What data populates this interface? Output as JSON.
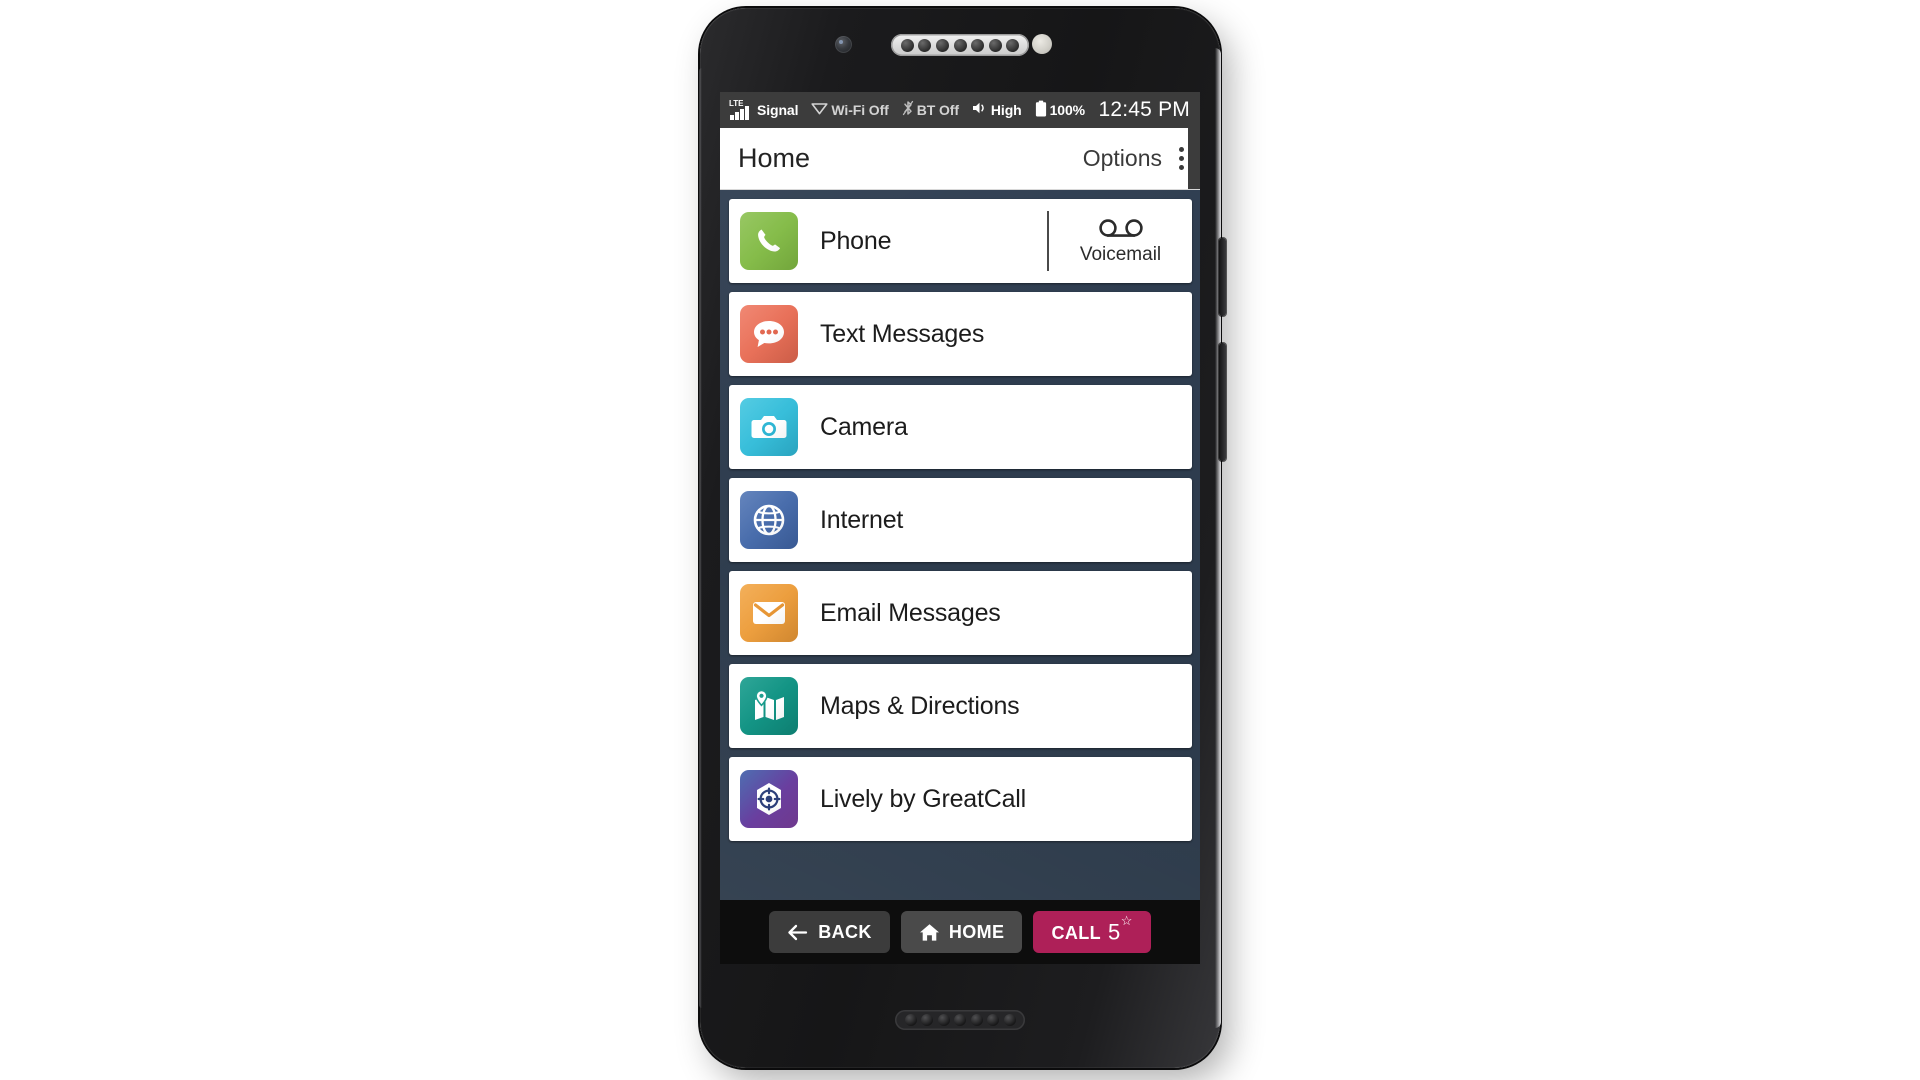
{
  "status_bar": {
    "network_type": "LTE",
    "signal_label": "Signal",
    "wifi_label": "Wi-Fi Off",
    "bluetooth_label": "BT Off",
    "volume_label": "High",
    "battery_label": "100%",
    "time": "12:45 PM"
  },
  "title_bar": {
    "title": "Home",
    "options_label": "Options"
  },
  "app_list": [
    {
      "label": "Phone",
      "icon": "phone-handset-icon",
      "color": "#8cc152",
      "secondary": {
        "label": "Voicemail",
        "icon": "voicemail-icon"
      }
    },
    {
      "label": "Text Messages",
      "icon": "speech-bubble-icon",
      "color": "#ef7b64"
    },
    {
      "label": "Camera",
      "icon": "camera-icon",
      "color": "#41c6e0"
    },
    {
      "label": "Internet",
      "icon": "globe-icon",
      "color": "#5377b5"
    },
    {
      "label": "Email Messages",
      "icon": "envelope-icon",
      "color": "#f2a748"
    },
    {
      "label": "Maps & Directions",
      "icon": "folded-map-pin-icon",
      "color": "#179c8c"
    },
    {
      "label": "Lively by GreatCall",
      "icon": "lively-target-icon",
      "color": "#6b3fa0"
    }
  ],
  "nav_bar": {
    "back_label": "BACK",
    "home_label": "HOME",
    "call_label": "CALL",
    "call_number": "5",
    "call_star": "☆",
    "call_color": "#ae2058"
  },
  "colors": {
    "screen_background": "#2f3d50",
    "status_bar": "#3c3c3c",
    "title_bar": "#ffffff",
    "nav_bar": "#0d0d0d",
    "row_background": "#ffffff",
    "page_background": "#ffffff"
  }
}
